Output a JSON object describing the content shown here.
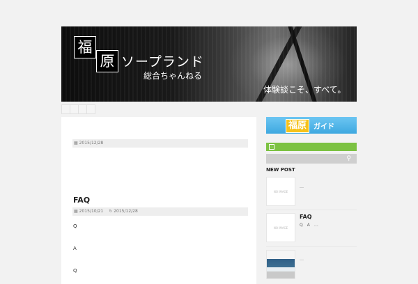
{
  "header": {
    "logo_char_1": "福",
    "logo_char_2": "原",
    "site_title": "ソープランド",
    "site_subtitle": "総合ちゃんねる",
    "tagline": "体験談こそ、すべて。"
  },
  "posts": [
    {
      "date": "2015/12/28"
    },
    {
      "title": "FAQ",
      "date": "2015/10/21",
      "updated": "2015/12/28",
      "body": [
        "Q",
        "A",
        "Q"
      ]
    }
  ],
  "sidebar": {
    "guide_banner": {
      "box": "福原",
      "text": "ガイド"
    },
    "new_post_heading": "NEW POST",
    "new_posts": [
      {
        "thumb": "NO IMAGE",
        "title": "",
        "excerpt": "…"
      },
      {
        "thumb": "NO IMAGE",
        "title": "FAQ",
        "excerpt": "Q　A　…"
      },
      {
        "thumb": "",
        "title": "",
        "excerpt": "…"
      }
    ]
  },
  "icons": {
    "calendar": "calendar-icon",
    "refresh": "refresh-icon",
    "rss": "rss-icon",
    "search": "search-icon"
  },
  "colors": {
    "guide_blue": "#4fb5e8",
    "guide_yellow": "#f6c21a",
    "rss_green": "#7cc242",
    "search_gray": "#cfcfcf"
  }
}
